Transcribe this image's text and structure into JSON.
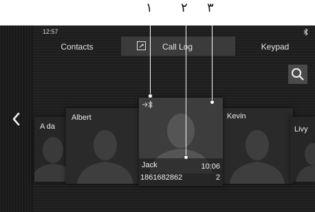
{
  "callouts": [
    "١",
    "٢",
    "٣"
  ],
  "status_bar": {
    "time": "12:57",
    "bluetooth_icon": "bluetooth-icon"
  },
  "tabs": [
    {
      "label": "Contacts",
      "active": false
    },
    {
      "label": "Call Log",
      "active": true,
      "icon": "phone-log-icon"
    },
    {
      "label": "Keypad",
      "active": false
    }
  ],
  "icons": {
    "search": "search-icon",
    "back": "chevron-left-icon",
    "avatar": "person-silhouette-icon",
    "call_source": "bluetooth-arrow-icon"
  },
  "cards": [
    {
      "name": "A da"
    },
    {
      "name": "Albert"
    },
    {
      "name": "Jack",
      "time": "10:06",
      "number": "1861682862",
      "count": "2"
    },
    {
      "name": "Kevin"
    },
    {
      "name": "Livy"
    }
  ],
  "colors": {
    "background": "#1e1e1e",
    "card": "#2a2a2a",
    "active_card": "#3d3d3d",
    "text": "#ececec"
  }
}
